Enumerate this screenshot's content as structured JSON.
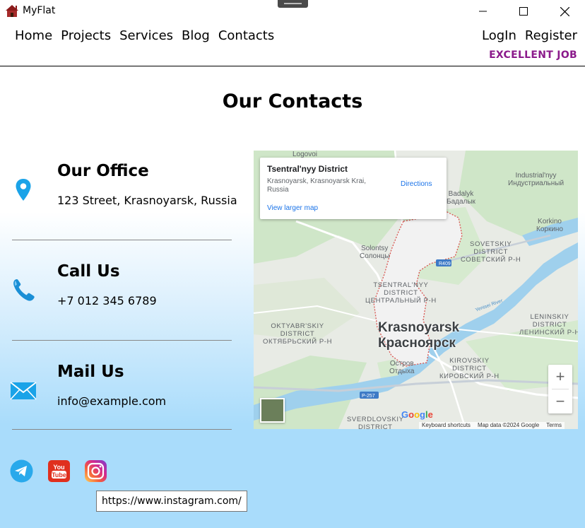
{
  "window": {
    "title": "MyFlat",
    "icon": "house-icon"
  },
  "nav": {
    "links": [
      "Home",
      "Projects",
      "Services",
      "Blog",
      "Contacts"
    ],
    "login": "LogIn",
    "register": "Register",
    "badge": "EXCELLENT JOB"
  },
  "page": {
    "title": "Our Contacts"
  },
  "contacts": {
    "office": {
      "title": "Our Office",
      "value": "123 Street, Krasnoyarsk, Russia",
      "icon": "location-pin-icon"
    },
    "phone": {
      "title": "Call Us",
      "value": "+7 012 345 6789",
      "icon": "phone-icon"
    },
    "mail": {
      "title": "Mail Us",
      "value": "info@example.com",
      "icon": "envelope-icon"
    }
  },
  "map": {
    "popup_title": "Tsentral'nyy District",
    "popup_address": "Krasnoyarsk, Krasnoyarsk Krai, Russia",
    "directions": "Directions",
    "view_larger": "View larger map",
    "labels": {
      "logovoi": "Logovoi",
      "industrial": "Industrial'nyy",
      "industrial_ru": "Индустриальный",
      "badalyk": "Badalyk",
      "badalyk_ru": "Бадалык",
      "korkino": "Korkino",
      "korkino_ru": "Коркино",
      "solontsy": "Solontsy",
      "solontsy_ru": "Солонцы",
      "sovetskiy": "SOVETSKIY",
      "sovetskiy_2": "DISTRICT",
      "sovetskiy_ru": "СОВЕТСКИЙ Р-Н",
      "r409": "R409",
      "tsentral": "TSENTRAL'NYY",
      "tsentral_2": "DISTRICT",
      "tsentral_ru": "ЦЕНТРАЛЬНЫЙ Р-Н",
      "yenisei": "Yenisei River",
      "leninskiy": "LENINSKIY",
      "leninskiy_2": "DISTRICT",
      "leninskiy_ru": "ЛЕНИНСКИЙ Р-Н",
      "oktyabr": "OKTYABR'SKIY",
      "oktyabr_2": "DISTRICT",
      "oktyabr_ru": "ОКТЯБРЬСКИЙ Р-Н",
      "city": "Krasnoyarsk",
      "city_ru": "Красноярск",
      "kirovskiy": "KIROVSKIY",
      "kirovskiy_2": "DISTRICT",
      "kirovskiy_ru": "КИРОВСКИЙ Р-Н",
      "ostrov": "Остров",
      "ostrov_2": "Отдыха",
      "p257": "P-257",
      "sverdlov": "SVERDLOVSKIY",
      "sverdlov_2": "DISTRICT"
    },
    "zoom_in": "+",
    "zoom_out": "−",
    "google": "Google",
    "keyboard": "Keyboard shortcuts",
    "map_data": "Map data ©2024 Google",
    "terms": "Terms"
  },
  "social": {
    "telegram_icon": "telegram-icon",
    "youtube_icon": "youtube-icon",
    "instagram_icon": "instagram-icon",
    "tooltip": "https://www.instagram.com/"
  },
  "colors": {
    "accent_purple": "#8b1a8b",
    "icon_blue": "#1aa3e8",
    "gradient_bottom": "#a9dcfb"
  }
}
